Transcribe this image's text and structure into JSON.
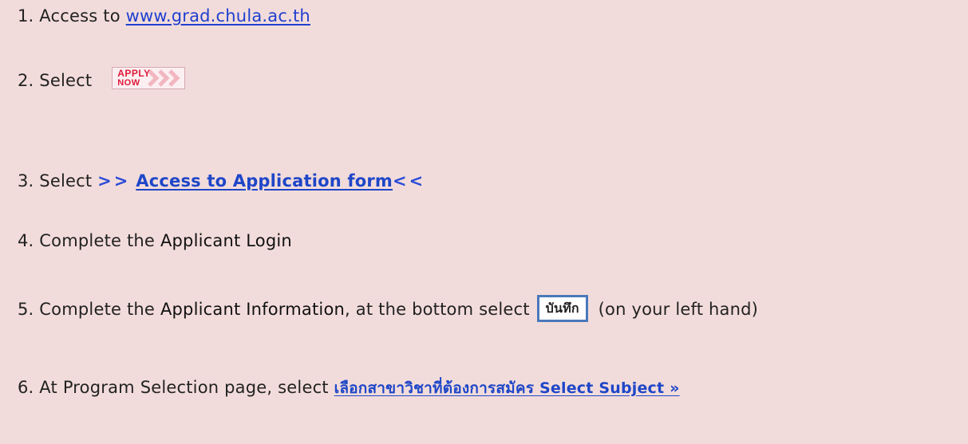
{
  "steps": {
    "s1": {
      "prefix": "1.  Access to ",
      "link": "www.grad.chula.ac.th"
    },
    "s2": {
      "prefix": "2. Select",
      "badge_top": "APPLY",
      "badge_bottom": "NOW"
    },
    "s3": {
      "prefix": "3. Select ",
      "arrows_left": ">>",
      "link": "Access to Application form",
      "arrows_right": "<<"
    },
    "s4": {
      "prefix": "4. Complete the ",
      "bold": "Applicant Login"
    },
    "s5": {
      "prefix": "5. Complete the ",
      "bold": "Applicant Information",
      "middle": ", at the bottom select ",
      "button": "บันทึก",
      "suffix": " (on your left hand)"
    },
    "s6": {
      "prefix": "6. At Program Selection page, select ",
      "link": "เลือกสาขาวิชาที่ต้องการสมัคร Select Subject »"
    }
  },
  "colors": {
    "background": "#f2dcdb",
    "link": "#1f3fcf",
    "apply_red": "#e01a3a",
    "button_border": "#4a78bb"
  },
  "icons": [
    "chevron-right-icon"
  ]
}
